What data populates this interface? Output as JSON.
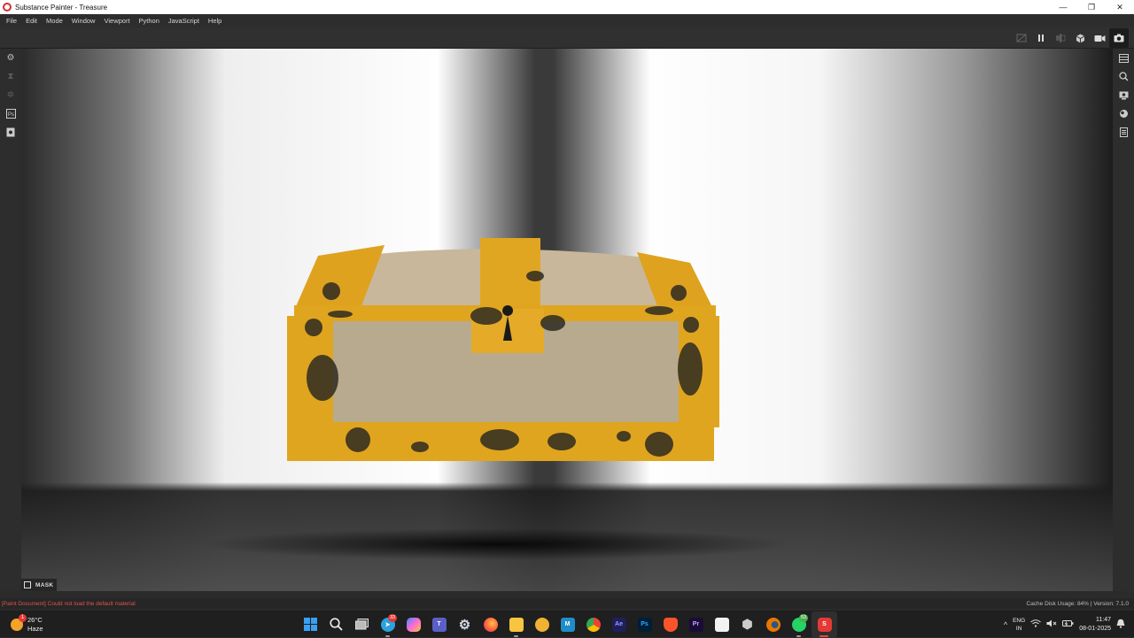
{
  "window": {
    "title": "Substance Painter - Treasure",
    "controls": {
      "minimize": "—",
      "maximize": "❐",
      "close": "✕"
    }
  },
  "menu": {
    "items": [
      "File",
      "Edit",
      "Mode",
      "Window",
      "Viewport",
      "Python",
      "JavaScript",
      "Help"
    ]
  },
  "toolbar": {
    "icons": [
      "hide-icon",
      "pause-icon",
      "split-view-icon",
      "cube-view-icon",
      "camera-icon",
      "screenshot-icon"
    ]
  },
  "left_sidebar": {
    "icons": [
      "settings-icon",
      "hourglass-icon",
      "gear-icon",
      "photoshop-export-icon",
      "document-icon"
    ]
  },
  "right_sidebar": {
    "icons": [
      "layers-icon",
      "zoom-icon",
      "display-settings-icon",
      "environment-icon",
      "log-icon"
    ]
  },
  "viewport": {
    "mask_label": "MASK",
    "colors": {
      "chest_trim": "#e0a51e",
      "chest_panel": "#b8aa8e",
      "chest_lid": "#c9b99c"
    }
  },
  "status": {
    "error": "[Paint Document] Could not load the default material",
    "right": "Cache Disk Usage:   84% | Version: 7.1.0"
  },
  "taskbar": {
    "weather": {
      "temp": "26°C",
      "condition": "Haze",
      "badge": "1"
    },
    "apps": [
      {
        "name": "start",
        "label": ""
      },
      {
        "name": "search",
        "label": ""
      },
      {
        "name": "task-view",
        "label": ""
      },
      {
        "name": "telegram",
        "label": "",
        "badge": "33"
      },
      {
        "name": "copilot",
        "label": ""
      },
      {
        "name": "teams",
        "label": ""
      },
      {
        "name": "settings",
        "label": ""
      },
      {
        "name": "firefox",
        "label": ""
      },
      {
        "name": "file-explorer",
        "label": ""
      },
      {
        "name": "app-yellow",
        "label": ""
      },
      {
        "name": "app-m",
        "label": "M"
      },
      {
        "name": "chrome",
        "label": ""
      },
      {
        "name": "after-effects",
        "label": "Ae"
      },
      {
        "name": "photoshop",
        "label": "Ps"
      },
      {
        "name": "brave",
        "label": ""
      },
      {
        "name": "premiere",
        "label": "Pr"
      },
      {
        "name": "app-white",
        "label": ""
      },
      {
        "name": "app-cube",
        "label": ""
      },
      {
        "name": "blender",
        "label": ""
      },
      {
        "name": "whatsapp",
        "label": "",
        "badge": "53"
      },
      {
        "name": "substance-painter",
        "label": "S"
      }
    ],
    "tray": {
      "chevron": "^",
      "lang_top": "ENG",
      "lang_bottom": "IN",
      "time": "11:47",
      "date": "08-01-2025"
    }
  }
}
